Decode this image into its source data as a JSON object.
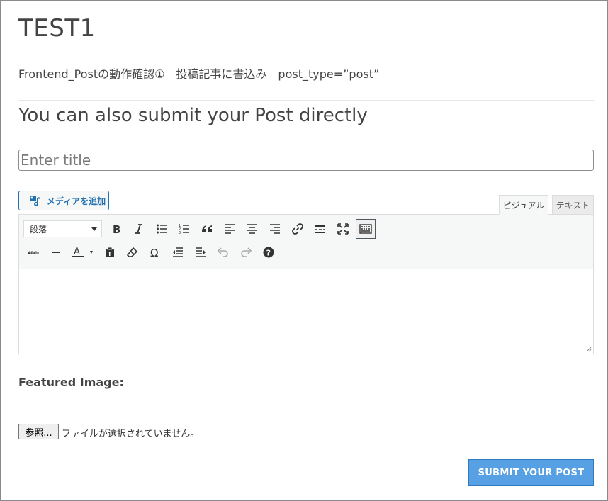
{
  "page": {
    "title": "TEST1",
    "description": "Frontend_Postの動作確認①　投稿記事に書込み　post_type=”post”",
    "form_heading": "You can also submit your Post directly"
  },
  "form": {
    "title_placeholder": "Enter title",
    "add_media_label": "メディアを追加",
    "tabs": {
      "visual": "ビジュアル",
      "text": "テキスト"
    },
    "format_select": "段落",
    "toolbar_row1": [
      "bold-icon",
      "italic-icon",
      "bullet-list-icon",
      "numbered-list-icon",
      "blockquote-icon",
      "align-left-icon",
      "align-center-icon",
      "align-right-icon",
      "link-icon",
      "read-more-icon",
      "fullscreen-icon",
      "toolbar-toggle-icon"
    ],
    "toolbar_row2": [
      "strikethrough-icon",
      "horizontal-line-icon",
      "text-color-icon",
      "paste-text-icon",
      "clear-formatting-icon",
      "special-character-icon",
      "outdent-icon",
      "indent-icon",
      "undo-icon",
      "redo-icon",
      "help-icon"
    ],
    "featured_image_label": "Featured Image:",
    "file_button_label": "参照...",
    "file_status": "ファイルが選択されていません。",
    "submit_label": "SUBMIT YOUR POST"
  },
  "colors": {
    "accent": "#2271b1",
    "submit_bg": "#56a0e3",
    "text": "#444444"
  }
}
